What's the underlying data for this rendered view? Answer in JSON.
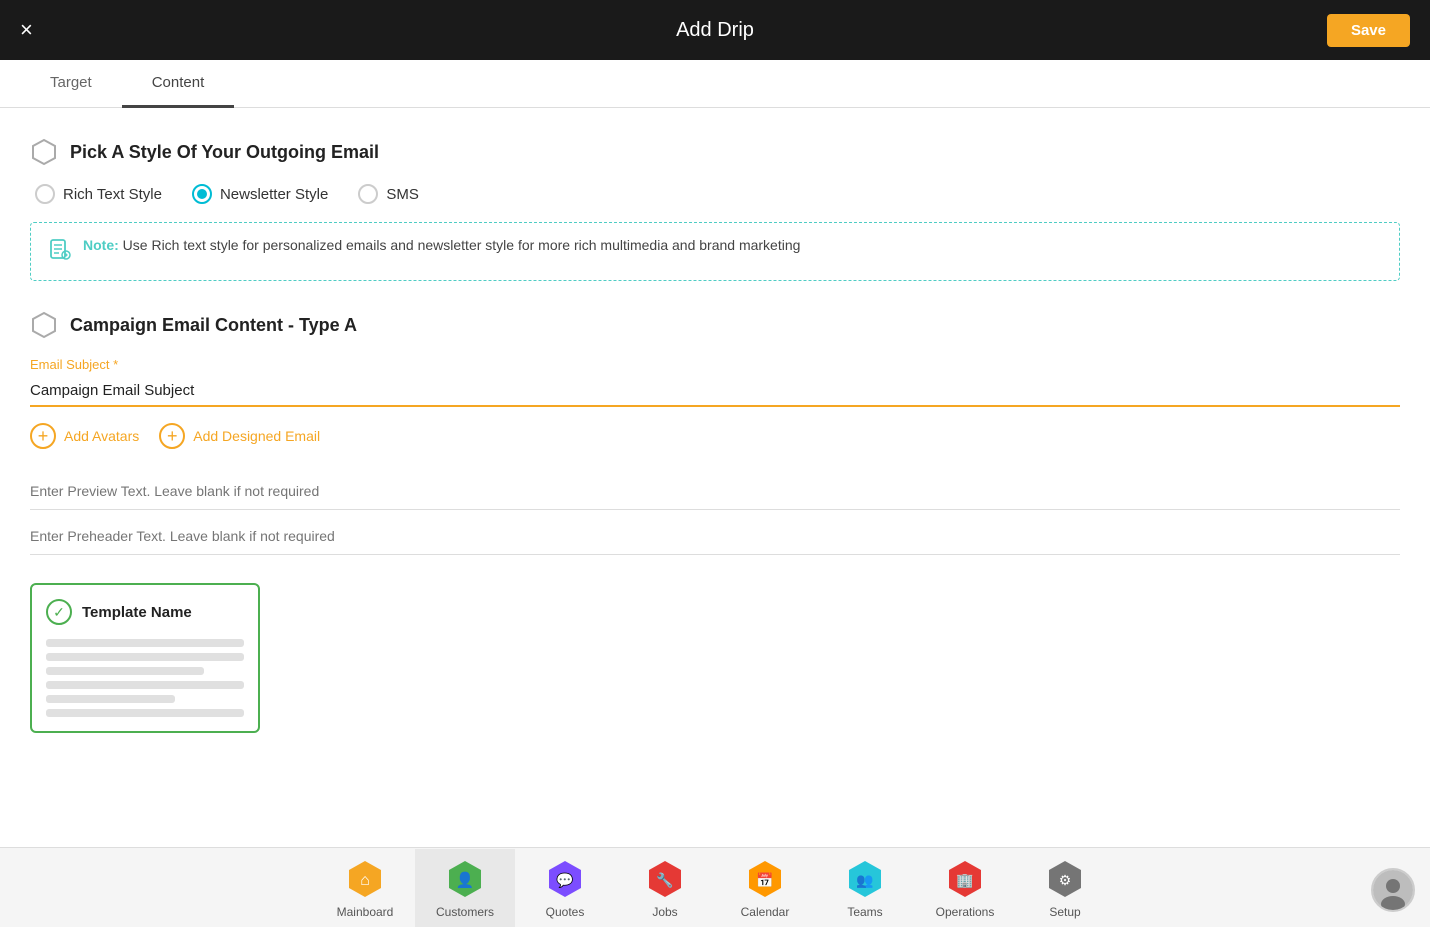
{
  "header": {
    "title": "Add Drip",
    "close_label": "×",
    "save_label": "Save"
  },
  "tabs": [
    {
      "id": "target",
      "label": "Target",
      "active": false
    },
    {
      "id": "content",
      "label": "Content",
      "active": true
    }
  ],
  "style_section": {
    "title": "Pick A Style Of Your Outgoing Email",
    "options": [
      {
        "id": "rich-text",
        "label": "Rich Text Style",
        "selected": false
      },
      {
        "id": "newsletter",
        "label": "Newsletter Style",
        "selected": true
      },
      {
        "id": "sms",
        "label": "SMS",
        "selected": false
      }
    ],
    "note": {
      "label": "Note:",
      "text": " Use Rich text style for personalized emails and newsletter style for more rich multimedia and brand marketing"
    }
  },
  "campaign_section": {
    "title": "Campaign Email Content - Type A",
    "email_subject_label": "Email Subject *",
    "email_subject_value": "Campaign Email Subject",
    "add_avatars_label": "Add Avatars",
    "add_designed_email_label": "Add Designed Email",
    "preview_text_placeholder": "Enter Preview Text. Leave blank if not required",
    "preheader_text_placeholder": "Enter Preheader Text. Leave blank if not required"
  },
  "template": {
    "name": "Template Name"
  },
  "bottom_nav": {
    "items": [
      {
        "id": "mainboard",
        "label": "Mainboard",
        "color": "#f5a623"
      },
      {
        "id": "customers",
        "label": "Customers",
        "color": "#4caf50",
        "active": true
      },
      {
        "id": "quotes",
        "label": "Quotes",
        "color": "#7c4dff"
      },
      {
        "id": "jobs",
        "label": "Jobs",
        "color": "#e53935"
      },
      {
        "id": "calendar",
        "label": "Calendar",
        "color": "#ff9800"
      },
      {
        "id": "teams",
        "label": "Teams",
        "color": "#26c6da"
      },
      {
        "id": "operations",
        "label": "Operations",
        "color": "#e53935"
      },
      {
        "id": "setup",
        "label": "Setup",
        "color": "#757575"
      }
    ]
  }
}
